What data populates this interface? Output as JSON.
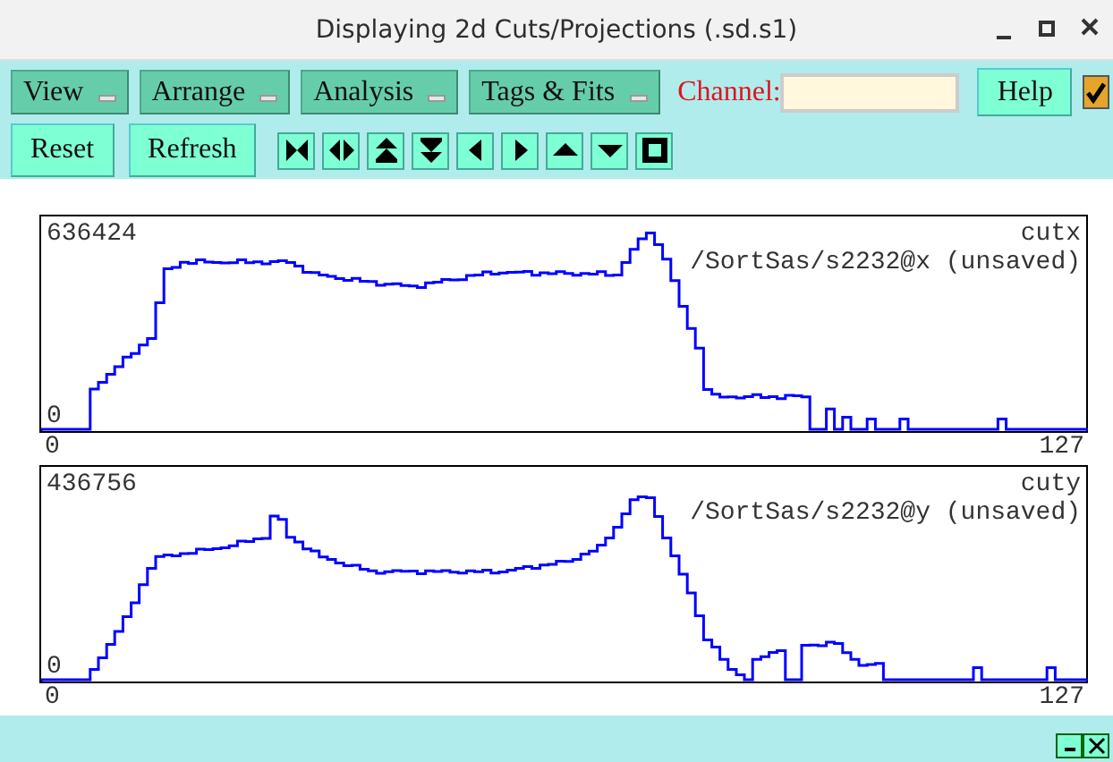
{
  "window": {
    "title": "Displaying 2d Cuts/Projections (.sd.s1)"
  },
  "menus": [
    {
      "label": "View"
    },
    {
      "label": "Arrange"
    },
    {
      "label": "Analysis"
    },
    {
      "label": "Tags & Fits"
    }
  ],
  "channel": {
    "label": "Channel:"
  },
  "help_button": "Help",
  "checkbox": {
    "checked": true
  },
  "buttons": [
    "Reset",
    "Refresh"
  ],
  "tools": [
    {
      "kind": "expand-h"
    },
    {
      "kind": "shrink-h"
    },
    {
      "kind": "expand-v"
    },
    {
      "kind": "shrink-v"
    },
    {
      "kind": "left"
    },
    {
      "kind": "right"
    },
    {
      "kind": "up"
    },
    {
      "kind": "down"
    },
    {
      "kind": "full"
    }
  ],
  "plots": [
    {
      "max": "636424",
      "name": "cutx",
      "source": "/SortSas/s2232@x (unsaved)",
      "ymin": "0",
      "xmin": "0",
      "xmax": "127"
    },
    {
      "max": "436756",
      "name": "cuty",
      "source": "/SortSas/s2232@y (unsaved)",
      "ymin": "0",
      "xmin": "0",
      "xmax": "127"
    }
  ]
}
